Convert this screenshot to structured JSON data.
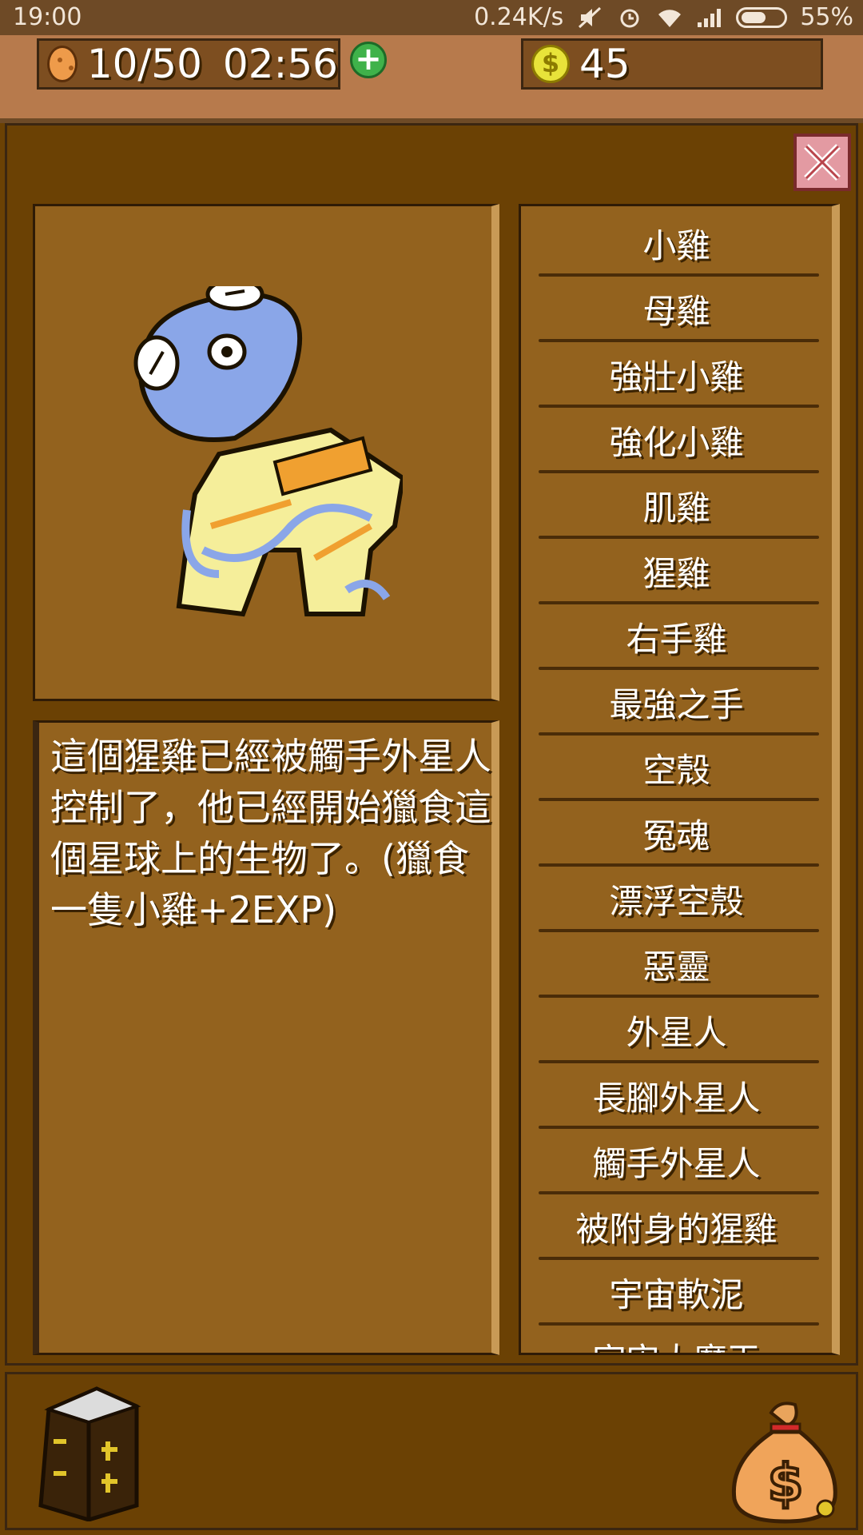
{
  "status_bar": {
    "time": "19:00",
    "net_speed": "0.24K/s",
    "battery": "55%"
  },
  "resources": {
    "energy": "10/50",
    "timer": "02:56",
    "plus_label": "+",
    "coin_symbol": "$",
    "coins": "45"
  },
  "description": {
    "text": "這個猩雞已經被觸手外星人控制了，他已經開始獵食這個星球上的生物了。(獵食一隻小雞+2EXP)"
  },
  "creature_list": [
    "小雞",
    "母雞",
    "強壯小雞",
    "強化小雞",
    "肌雞",
    "猩雞",
    "右手雞",
    "最強之手",
    "空殼",
    "冤魂",
    "漂浮空殼",
    "惡靈",
    "外星人",
    "長腳外星人",
    "觸手外星人",
    "被附身的猩雞",
    "宇宙軟泥",
    "宇宙大魔王"
  ],
  "colors": {
    "background": "#6b4104",
    "panel": "#93621e",
    "topbar": "#b77a4c",
    "close_button": "#e39aa2",
    "plus_button": "#3fb24a"
  },
  "icons": {
    "energy": "cookie-icon",
    "coin": "dollar-coin-icon",
    "close": "close-icon",
    "book": "book-icon",
    "bag": "money-bag-icon"
  }
}
